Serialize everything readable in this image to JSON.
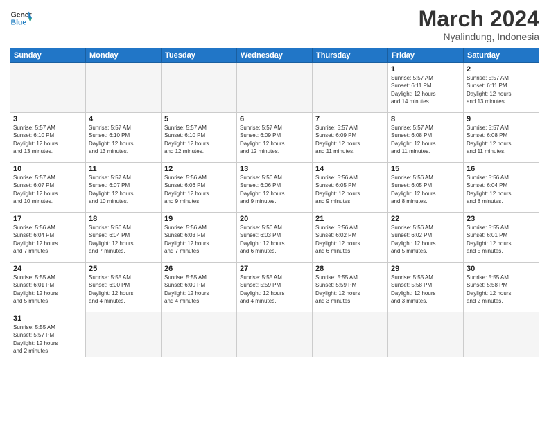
{
  "header": {
    "logo_general": "General",
    "logo_blue": "Blue",
    "month_title": "March 2024",
    "subtitle": "Nyalindung, Indonesia"
  },
  "weekdays": [
    "Sunday",
    "Monday",
    "Tuesday",
    "Wednesday",
    "Thursday",
    "Friday",
    "Saturday"
  ],
  "weeks": [
    [
      {
        "day": "",
        "info": "",
        "empty": true
      },
      {
        "day": "",
        "info": "",
        "empty": true
      },
      {
        "day": "",
        "info": "",
        "empty": true
      },
      {
        "day": "",
        "info": "",
        "empty": true
      },
      {
        "day": "",
        "info": "",
        "empty": true
      },
      {
        "day": "1",
        "info": "Sunrise: 5:57 AM\nSunset: 6:11 PM\nDaylight: 12 hours\nand 14 minutes."
      },
      {
        "day": "2",
        "info": "Sunrise: 5:57 AM\nSunset: 6:11 PM\nDaylight: 12 hours\nand 13 minutes."
      }
    ],
    [
      {
        "day": "3",
        "info": "Sunrise: 5:57 AM\nSunset: 6:10 PM\nDaylight: 12 hours\nand 13 minutes."
      },
      {
        "day": "4",
        "info": "Sunrise: 5:57 AM\nSunset: 6:10 PM\nDaylight: 12 hours\nand 13 minutes."
      },
      {
        "day": "5",
        "info": "Sunrise: 5:57 AM\nSunset: 6:10 PM\nDaylight: 12 hours\nand 12 minutes."
      },
      {
        "day": "6",
        "info": "Sunrise: 5:57 AM\nSunset: 6:09 PM\nDaylight: 12 hours\nand 12 minutes."
      },
      {
        "day": "7",
        "info": "Sunrise: 5:57 AM\nSunset: 6:09 PM\nDaylight: 12 hours\nand 11 minutes."
      },
      {
        "day": "8",
        "info": "Sunrise: 5:57 AM\nSunset: 6:08 PM\nDaylight: 12 hours\nand 11 minutes."
      },
      {
        "day": "9",
        "info": "Sunrise: 5:57 AM\nSunset: 6:08 PM\nDaylight: 12 hours\nand 11 minutes."
      }
    ],
    [
      {
        "day": "10",
        "info": "Sunrise: 5:57 AM\nSunset: 6:07 PM\nDaylight: 12 hours\nand 10 minutes."
      },
      {
        "day": "11",
        "info": "Sunrise: 5:57 AM\nSunset: 6:07 PM\nDaylight: 12 hours\nand 10 minutes."
      },
      {
        "day": "12",
        "info": "Sunrise: 5:56 AM\nSunset: 6:06 PM\nDaylight: 12 hours\nand 9 minutes."
      },
      {
        "day": "13",
        "info": "Sunrise: 5:56 AM\nSunset: 6:06 PM\nDaylight: 12 hours\nand 9 minutes."
      },
      {
        "day": "14",
        "info": "Sunrise: 5:56 AM\nSunset: 6:05 PM\nDaylight: 12 hours\nand 9 minutes."
      },
      {
        "day": "15",
        "info": "Sunrise: 5:56 AM\nSunset: 6:05 PM\nDaylight: 12 hours\nand 8 minutes."
      },
      {
        "day": "16",
        "info": "Sunrise: 5:56 AM\nSunset: 6:04 PM\nDaylight: 12 hours\nand 8 minutes."
      }
    ],
    [
      {
        "day": "17",
        "info": "Sunrise: 5:56 AM\nSunset: 6:04 PM\nDaylight: 12 hours\nand 7 minutes."
      },
      {
        "day": "18",
        "info": "Sunrise: 5:56 AM\nSunset: 6:04 PM\nDaylight: 12 hours\nand 7 minutes."
      },
      {
        "day": "19",
        "info": "Sunrise: 5:56 AM\nSunset: 6:03 PM\nDaylight: 12 hours\nand 7 minutes."
      },
      {
        "day": "20",
        "info": "Sunrise: 5:56 AM\nSunset: 6:03 PM\nDaylight: 12 hours\nand 6 minutes."
      },
      {
        "day": "21",
        "info": "Sunrise: 5:56 AM\nSunset: 6:02 PM\nDaylight: 12 hours\nand 6 minutes."
      },
      {
        "day": "22",
        "info": "Sunrise: 5:56 AM\nSunset: 6:02 PM\nDaylight: 12 hours\nand 5 minutes."
      },
      {
        "day": "23",
        "info": "Sunrise: 5:55 AM\nSunset: 6:01 PM\nDaylight: 12 hours\nand 5 minutes."
      }
    ],
    [
      {
        "day": "24",
        "info": "Sunrise: 5:55 AM\nSunset: 6:01 PM\nDaylight: 12 hours\nand 5 minutes."
      },
      {
        "day": "25",
        "info": "Sunrise: 5:55 AM\nSunset: 6:00 PM\nDaylight: 12 hours\nand 4 minutes."
      },
      {
        "day": "26",
        "info": "Sunrise: 5:55 AM\nSunset: 6:00 PM\nDaylight: 12 hours\nand 4 minutes."
      },
      {
        "day": "27",
        "info": "Sunrise: 5:55 AM\nSunset: 5:59 PM\nDaylight: 12 hours\nand 4 minutes."
      },
      {
        "day": "28",
        "info": "Sunrise: 5:55 AM\nSunset: 5:59 PM\nDaylight: 12 hours\nand 3 minutes."
      },
      {
        "day": "29",
        "info": "Sunrise: 5:55 AM\nSunset: 5:58 PM\nDaylight: 12 hours\nand 3 minutes."
      },
      {
        "day": "30",
        "info": "Sunrise: 5:55 AM\nSunset: 5:58 PM\nDaylight: 12 hours\nand 2 minutes."
      }
    ],
    [
      {
        "day": "31",
        "info": "Sunrise: 5:55 AM\nSunset: 5:57 PM\nDaylight: 12 hours\nand 2 minutes."
      },
      {
        "day": "",
        "info": "",
        "empty": true
      },
      {
        "day": "",
        "info": "",
        "empty": true
      },
      {
        "day": "",
        "info": "",
        "empty": true
      },
      {
        "day": "",
        "info": "",
        "empty": true
      },
      {
        "day": "",
        "info": "",
        "empty": true
      },
      {
        "day": "",
        "info": "",
        "empty": true
      }
    ]
  ]
}
